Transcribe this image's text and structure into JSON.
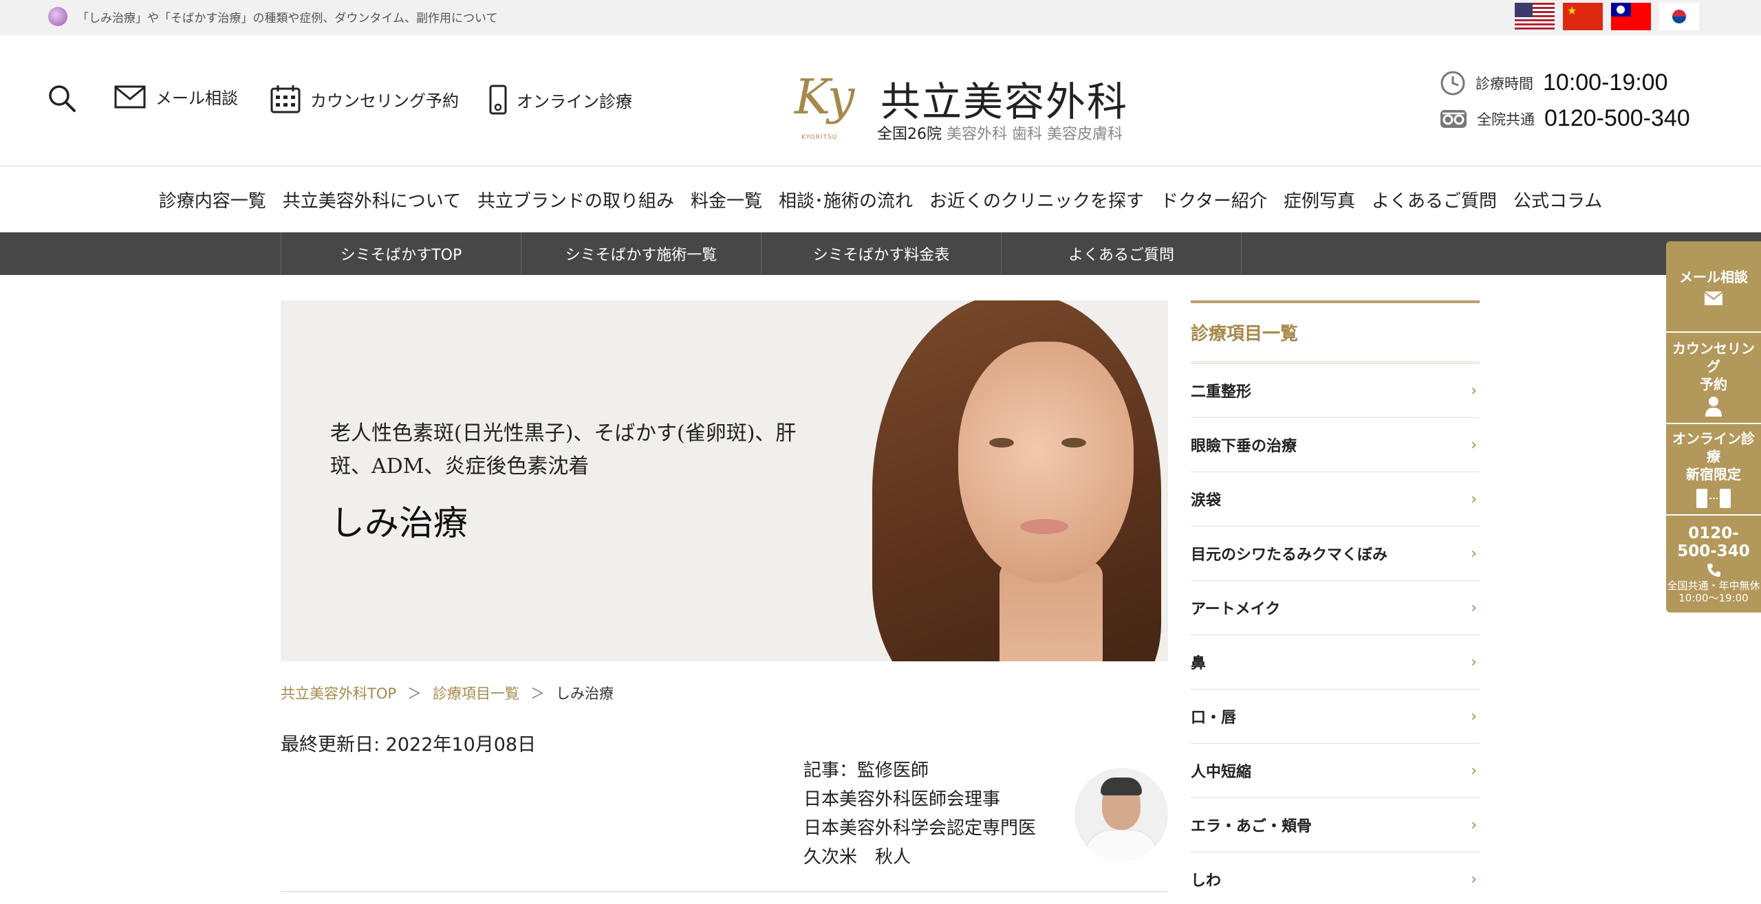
{
  "topbar": {
    "text": "「しみ治療」や「そばかす治療」の種類や症例、ダウンタイム、副作用について",
    "flags": [
      "flag-us-icon",
      "flag-china-icon",
      "flag-taiwan-icon",
      "flag-korea-icon"
    ]
  },
  "header": {
    "mail_label": "メール相談",
    "counsel_label": "カウンセリング予約",
    "online_label": "オンライン診療",
    "brand_monogram": "Ky",
    "brand_monogram_sub": "KYORITSU",
    "brand_name": "共立美容外科",
    "brand_sub_strong": "全国26院",
    "brand_sub_soft": "美容外科 歯科 美容皮膚科",
    "hours_label": "診療時間",
    "hours_value": "10:00-19:00",
    "phone_label": "全院共通",
    "phone_value": "0120-500-340"
  },
  "gnav": [
    "診療内容一覧",
    "共立美容外科について",
    "共立ブランドの取り組み",
    "料金一覧",
    "相談･施術の流れ",
    "お近くのクリニックを探す",
    "ドクター紹介",
    "症例写真",
    "よくあるご質問",
    "公式コラム"
  ],
  "subnav": [
    "シミそばかすTOP",
    "シミそばかす施術一覧",
    "シミそばかす料金表",
    "よくあるご質問"
  ],
  "hero": {
    "subtitle": "老人性色素斑(日光性黒子)、そばかす(雀卵斑)、肝斑、ADM、炎症後色素沈着",
    "title": "しみ治療"
  },
  "breadcrumb": {
    "home": "共立美容外科TOP",
    "sep": "＞",
    "list": "診療項目一覧",
    "current": "しみ治療"
  },
  "updated": "最終更新日:  2022年10月08日",
  "author": {
    "line1": "記事：監修医師",
    "line2": "日本美容外科医師会理事",
    "line3": "日本美容外科学会認定専門医",
    "line4": "久次米　秋人"
  },
  "sidebar": {
    "heading": "診療項目一覧",
    "items": [
      "二重整形",
      "眼瞼下垂の治療",
      "涙袋",
      "目元のシワたるみクマくぼみ",
      "アートメイク",
      "鼻",
      "口・唇",
      "人中短縮",
      "エラ・あご・頬骨",
      "しわ"
    ],
    "chevron": "›"
  },
  "float": {
    "mail": "メール相談",
    "counsel_1": "カウンセリング",
    "counsel_2": "予約",
    "online_1": "オンライン診療",
    "online_2": "新宿限定",
    "phone_1": "0120-",
    "phone_2": "500-340",
    "phone_note_1": "全国共通・年中無休",
    "phone_note_2": "10:00〜19:00"
  },
  "colors": {
    "gold": "#a6884b",
    "float_bg": "#b3985c",
    "subnav_bg": "#474747"
  }
}
